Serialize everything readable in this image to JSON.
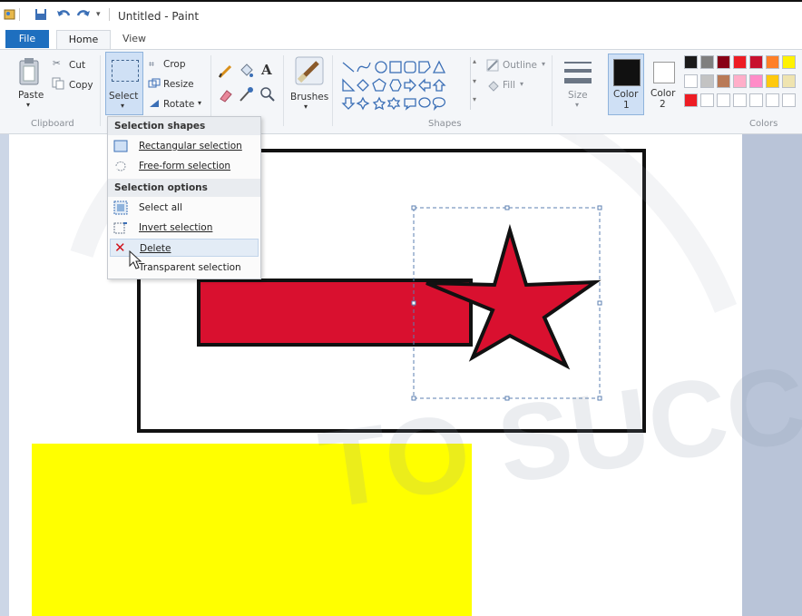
{
  "window": {
    "title": "Untitled - Paint"
  },
  "tabs": [
    {
      "label": "File"
    },
    {
      "label": "Home"
    },
    {
      "label": "View"
    }
  ],
  "clipboard": {
    "paste": "Paste",
    "cut": "Cut",
    "copy": "Copy",
    "group": "Clipboard"
  },
  "image": {
    "select": "Select",
    "crop": "Crop",
    "resize": "Resize",
    "rotate": "Rotate"
  },
  "tools": {
    "brushes": "Brushes"
  },
  "shapes": {
    "outline": "Outline",
    "fill": "Fill",
    "group": "Shapes"
  },
  "size": {
    "label": "Size"
  },
  "colors": {
    "color1_line1": "Color",
    "color1_line2": "1",
    "color2_line1": "Color",
    "color2_line2": "2",
    "group": "Colors",
    "palette_row1": [
      "#1a1a1a",
      "#7f7f7f",
      "#880015",
      "#ed1c24",
      "#c8102e",
      "#ff7f27",
      "#fff200"
    ],
    "palette_row2": [
      "#ffffff",
      "#c3c3c3",
      "#b97a57",
      "#ffaec9",
      "#ff8cc8",
      "#ffc90e",
      "#efe4b0"
    ],
    "palette_row3": [
      "#ed1c24",
      "#ffffff",
      "#ffffff",
      "#ffffff",
      "#ffffff",
      "#ffffff",
      "#ffffff"
    ],
    "color1": "#111111",
    "color2": "#ffffff"
  },
  "select_menu": {
    "section1": "Selection shapes",
    "rect": "Rectangular selection",
    "freeform": "Free-form selection",
    "section2": "Selection options",
    "select_all": "Select all",
    "invert": "Invert selection",
    "delete": "Delete",
    "transparent": "Transparent selection"
  },
  "drawing": {
    "bar_color": "#d9102f",
    "star_color": "#d9102f",
    "yellow": "#ffff00"
  },
  "watermark": {
    "text": "TO SUCC"
  }
}
